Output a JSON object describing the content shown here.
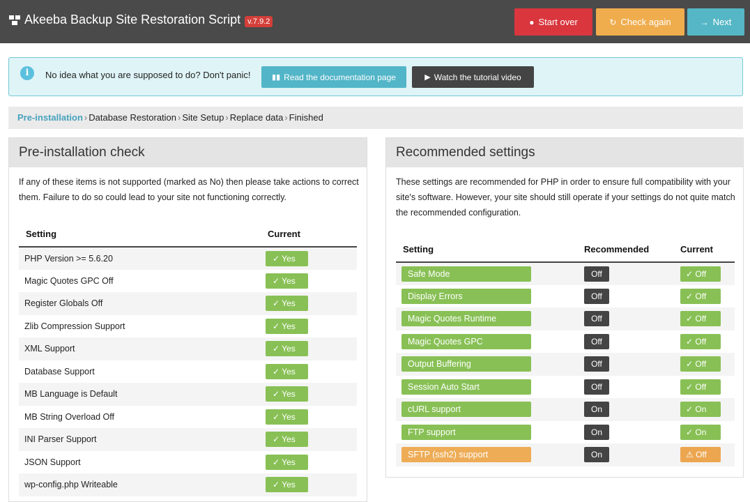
{
  "header": {
    "title": "Akeeba Backup Site Restoration Script",
    "version": "v.7.9.2",
    "buttons": {
      "start_over": "Start over",
      "check_again": "Check again",
      "next": "Next"
    }
  },
  "info": {
    "text": "No idea what you are supposed to do? Don't panic!",
    "doc_button": "Read the documentation page",
    "video_button": "Watch the tutorial video"
  },
  "breadcrumb": [
    "Pre-installation",
    "Database Restoration",
    "Site Setup",
    "Replace data",
    "Finished"
  ],
  "preinstall": {
    "title": "Pre-installation check",
    "description": "If any of these items is not supported (marked as No) then please take actions to correct them. Failure to do so could lead to your site not functioning correctly.",
    "col_setting": "Setting",
    "col_current": "Current",
    "rows": [
      {
        "setting": "PHP Version >= 5.6.20",
        "current": "Yes"
      },
      {
        "setting": "Magic Quotes GPC Off",
        "current": "Yes"
      },
      {
        "setting": "Register Globals Off",
        "current": "Yes"
      },
      {
        "setting": "Zlib Compression Support",
        "current": "Yes"
      },
      {
        "setting": "XML Support",
        "current": "Yes"
      },
      {
        "setting": "Database Support",
        "current": "Yes"
      },
      {
        "setting": "MB Language is Default",
        "current": "Yes"
      },
      {
        "setting": "MB String Overload Off",
        "current": "Yes"
      },
      {
        "setting": "INI Parser Support",
        "current": "Yes"
      },
      {
        "setting": "JSON Support",
        "current": "Yes"
      },
      {
        "setting": "wp-config.php Writeable",
        "current": "Yes"
      }
    ]
  },
  "recommended": {
    "title": "Recommended settings",
    "description": "These settings are recommended for PHP in order to ensure full compatibility with your site's software. However, your site should still operate if your settings do not quite match the recommended configuration.",
    "col_setting": "Setting",
    "col_recommended": "Recommended",
    "col_current": "Current",
    "rows": [
      {
        "setting": "Safe Mode",
        "recommended": "Off",
        "current": "Off",
        "status": "ok"
      },
      {
        "setting": "Display Errors",
        "recommended": "Off",
        "current": "Off",
        "status": "ok"
      },
      {
        "setting": "Magic Quotes Runtime",
        "recommended": "Off",
        "current": "Off",
        "status": "ok"
      },
      {
        "setting": "Magic Quotes GPC",
        "recommended": "Off",
        "current": "Off",
        "status": "ok"
      },
      {
        "setting": "Output Buffering",
        "recommended": "Off",
        "current": "Off",
        "status": "ok"
      },
      {
        "setting": "Session Auto Start",
        "recommended": "Off",
        "current": "Off",
        "status": "ok"
      },
      {
        "setting": "cURL support",
        "recommended": "On",
        "current": "On",
        "status": "ok"
      },
      {
        "setting": "FTP support",
        "recommended": "On",
        "current": "On",
        "status": "ok"
      },
      {
        "setting": "SFTP (ssh2) support",
        "recommended": "On",
        "current": "Off",
        "status": "warn"
      }
    ]
  },
  "colors": {
    "header_bg": "#4a4a4a",
    "danger": "#d9363e",
    "warning": "#f0ad4e",
    "info": "#55b7c5",
    "success": "#88c055"
  }
}
